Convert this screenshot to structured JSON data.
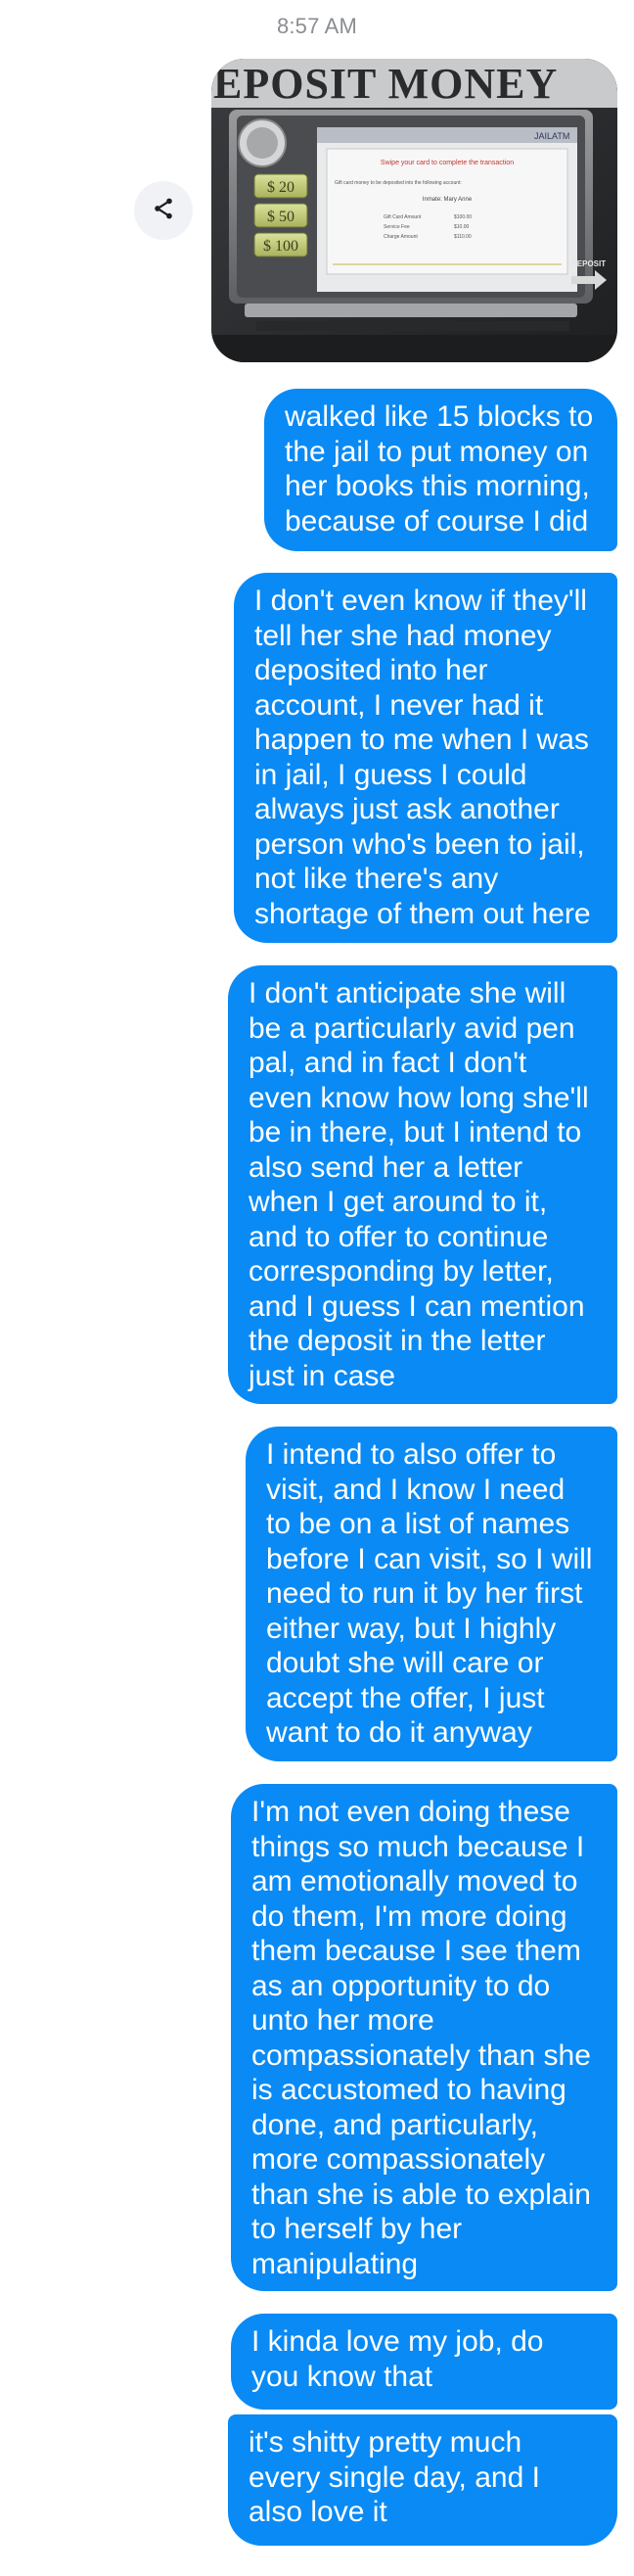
{
  "timestamp": "8:57 AM",
  "share_icon": "share-icon",
  "photo": {
    "banner_text": "EPOSIT MONEY",
    "jail_atm_label": "JAILATM",
    "screen_heading": "Swipe your card to complete the transaction",
    "screen_body": "Gift card money to be deposited into the following account:",
    "inmate_line": "Inmate: Mary Anne",
    "rows": [
      {
        "label": "Gift Card Amount",
        "value": "$100.00"
      },
      {
        "label": "Service Fee",
        "value": "$10.00"
      },
      {
        "label": "Charge Amount",
        "value": "$110.00"
      }
    ],
    "amount_buttons": [
      "$ 20",
      "$ 50",
      "$ 100"
    ],
    "side_label": "DEPOSIT"
  },
  "messages": [
    {
      "id": "msg1",
      "text": "walked like 15 blocks to the jail to put money on her books this morning, because of course I did"
    },
    {
      "id": "msg2",
      "text": "I don't even know if they'll tell her she had money deposited into her account, I never had it happen to me when I was in jail, I guess I could always just ask another person who's been to jail, not like there's any shortage of them out here"
    },
    {
      "id": "msg3",
      "text": "I don't anticipate she will be a particularly avid pen pal, and in fact I don't even know how long she'll be in there, but I intend to also send her a letter when I get around to it, and to offer to continue corresponding by letter, and I guess I can mention the deposit in the letter just in case"
    },
    {
      "id": "msg4",
      "text": "I intend to also offer to visit, and I know I need to be on a list of names before I can visit, so I will need to run it by her first either way, but I highly doubt she will care or accept the offer, I just want to do it anyway"
    },
    {
      "id": "msg5",
      "text": "I'm not even doing these things so much because I am emotionally moved to do them, I'm more doing them because I see them as an opportunity to do unto her more compassionately than she is accustomed to having done, and particularly, more compassionately than she is able to explain to herself by her manipulating"
    },
    {
      "id": "msg6",
      "text": "I kinda love my job, do you know that"
    },
    {
      "id": "msg7",
      "text": "it's shitty pretty much every single day, and I also love it"
    }
  ],
  "colors": {
    "bubble": "#0a8af5",
    "bubble_text": "#ffffff",
    "timestamp": "#8a8d91",
    "share_bg": "#f0f2f5"
  }
}
